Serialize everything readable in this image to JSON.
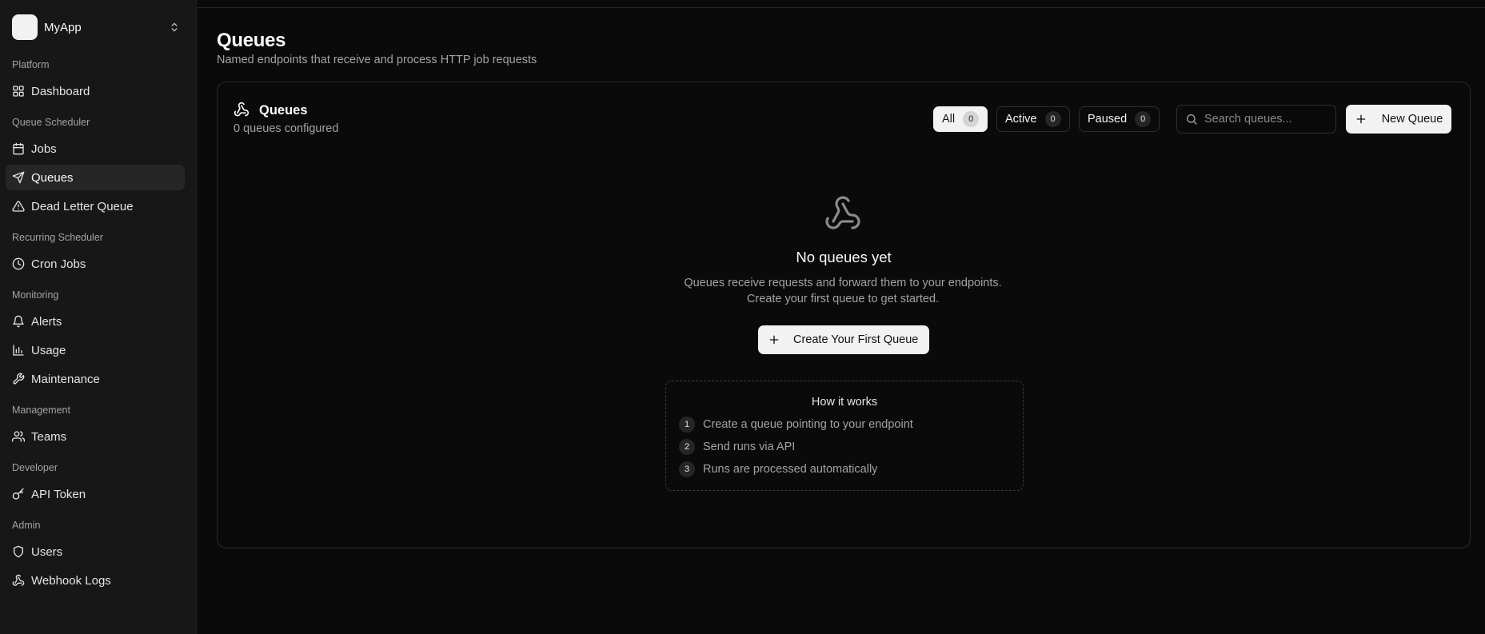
{
  "app": {
    "name": "MyApp"
  },
  "sidebar": {
    "groups": [
      {
        "label": "Platform",
        "items": [
          {
            "label": "Dashboard",
            "icon": "grid-icon"
          }
        ]
      },
      {
        "label": "Queue Scheduler",
        "items": [
          {
            "label": "Jobs",
            "icon": "calendar-icon"
          },
          {
            "label": "Queues",
            "icon": "send-icon",
            "active": true
          },
          {
            "label": "Dead Letter Queue",
            "icon": "alert-triangle-icon"
          }
        ]
      },
      {
        "label": "Recurring Scheduler",
        "items": [
          {
            "label": "Cron Jobs",
            "icon": "clock-icon"
          }
        ]
      },
      {
        "label": "Monitoring",
        "items": [
          {
            "label": "Alerts",
            "icon": "bell-icon"
          },
          {
            "label": "Usage",
            "icon": "bar-chart-icon"
          },
          {
            "label": "Maintenance",
            "icon": "wrench-icon"
          }
        ]
      },
      {
        "label": "Management",
        "items": [
          {
            "label": "Teams",
            "icon": "users-icon"
          }
        ]
      },
      {
        "label": "Developer",
        "items": [
          {
            "label": "API Token",
            "icon": "key-icon"
          }
        ]
      },
      {
        "label": "Admin",
        "items": [
          {
            "label": "Users",
            "icon": "shield-icon"
          },
          {
            "label": "Webhook Logs",
            "icon": "webhook-icon"
          }
        ]
      }
    ]
  },
  "page": {
    "title": "Queues",
    "subtitle": "Named endpoints that receive and process HTTP job requests"
  },
  "card": {
    "title": "Queues",
    "subtitle": "0 queues configured",
    "filters": [
      {
        "label": "All",
        "count": "0",
        "active": true
      },
      {
        "label": "Active",
        "count": "0"
      },
      {
        "label": "Paused",
        "count": "0"
      }
    ],
    "search_placeholder": "Search queues...",
    "new_button": "New Queue"
  },
  "empty_state": {
    "title": "No queues yet",
    "description": "Queues receive requests and forward them to your endpoints. Create your first queue to get started.",
    "create_button": "Create Your First Queue"
  },
  "how_it_works": {
    "title": "How it works",
    "steps": [
      {
        "num": "1",
        "text": "Create a queue pointing to your endpoint"
      },
      {
        "num": "2",
        "text": "Send runs via API"
      },
      {
        "num": "3",
        "text": "Runs are processed automatically"
      }
    ]
  },
  "colors": {
    "background": "#0a0a0a",
    "sidebar": "#171717",
    "button": "#f2f2f2",
    "muted_text": "#a3a3a3"
  }
}
